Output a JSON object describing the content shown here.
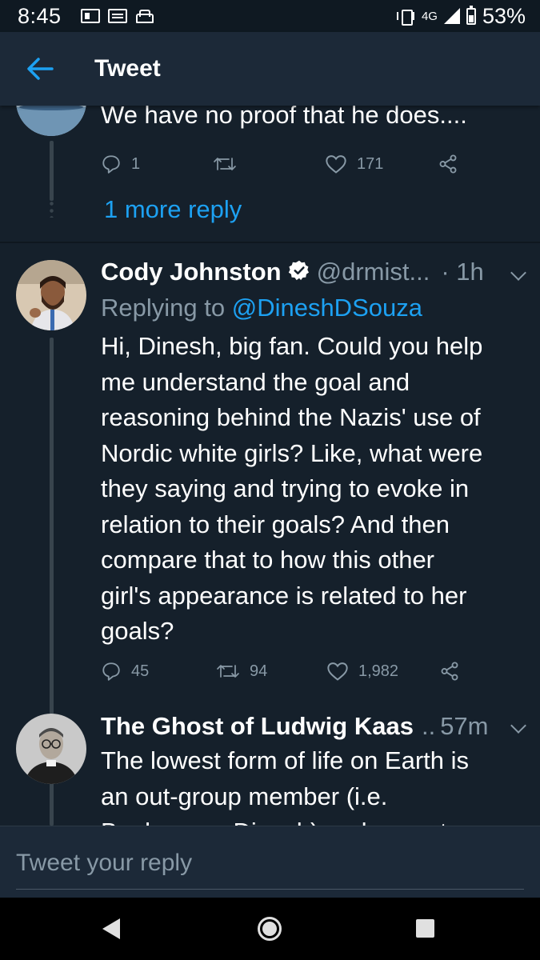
{
  "status_bar": {
    "time": "8:45",
    "network": "4G",
    "battery": "53%",
    "left_icons": [
      "news-icon",
      "calendar-icon",
      "car-icon"
    ],
    "right_icons": [
      "vibrate-icon",
      "signal-icon",
      "battery-icon"
    ]
  },
  "header": {
    "title": "Tweet",
    "back_icon": "arrow-left-icon"
  },
  "colors": {
    "background": "#15202b",
    "header": "#1c2938",
    "accent": "#1da1f2",
    "secondary_text": "#8899a6",
    "thread_line": "#38444d"
  },
  "tweets": [
    {
      "text_fragment": "We have no proof that he does....",
      "reply_count": "1",
      "retweet_count": "",
      "like_count": "171",
      "more_replies": "1 more reply"
    },
    {
      "name": "Cody Johnston",
      "verified": true,
      "handle": "@drmist...",
      "time": "· 1h",
      "replying_prefix": "Replying to ",
      "replying_to": "@DineshDSouza",
      "text_lines": [
        "Hi, Dinesh, big fan. Could you help",
        "me understand the goal and",
        "reasoning behind the Nazis' use of",
        "Nordic white girls? Like, what were",
        "they saying and trying to evoke in",
        "relation to their goals? And then",
        "compare that to how this other",
        "girl's appearance is related to her",
        "goals?"
      ],
      "reply_count": "45",
      "retweet_count": "94",
      "like_count": "1,982"
    },
    {
      "name": "The Ghost of Ludwig Kaas",
      "handle_truncated": "..",
      "time": "57m",
      "text_lines": [
        "The lowest form of life on Earth is",
        "an out-group member (i.e.",
        "Bookeeper, Dinesh) and accept"
      ]
    }
  ],
  "reply_box": {
    "placeholder": "Tweet your reply"
  },
  "nav": {
    "icons": [
      "back-triangle-icon",
      "home-circle-icon",
      "recents-square-icon"
    ]
  }
}
